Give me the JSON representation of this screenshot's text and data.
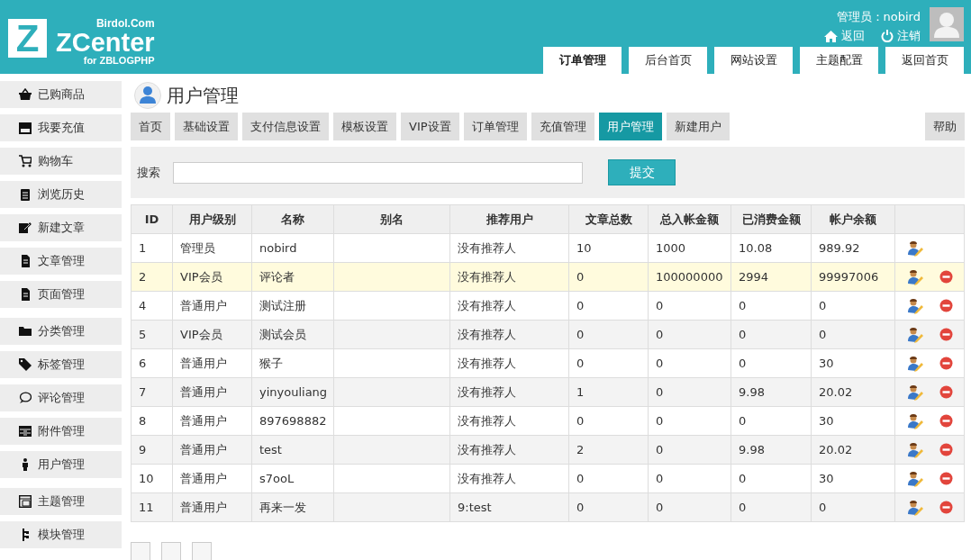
{
  "logo": {
    "letter": "Z",
    "site": "Birdol.Com",
    "name": "ZCenter",
    "sub": "for ZBLOGPHP"
  },
  "user": {
    "label": "管理员：nobird",
    "back": "返回",
    "logout": "注销"
  },
  "top_tabs": [
    {
      "label": "订单管理",
      "selected": true
    },
    {
      "label": "后台首页",
      "selected": false
    },
    {
      "label": "网站设置",
      "selected": false
    },
    {
      "label": "主题配置",
      "selected": false
    },
    {
      "label": "返回首页",
      "selected": false
    }
  ],
  "sidebar": {
    "groups": [
      [
        {
          "label": "已购商品",
          "kind": "basket"
        },
        {
          "label": "我要充值",
          "kind": "store"
        },
        {
          "label": "购物车",
          "kind": "cart"
        },
        {
          "label": "浏览历史",
          "kind": "clipboard"
        },
        {
          "label": "新建文章",
          "kind": "edit"
        },
        {
          "label": "文章管理",
          "kind": "docs"
        },
        {
          "label": "页面管理",
          "kind": "docs"
        }
      ],
      [
        {
          "label": "分类管理",
          "kind": "folder"
        },
        {
          "label": "标签管理",
          "kind": "tag"
        },
        {
          "label": "评论管理",
          "kind": "comment"
        },
        {
          "label": "附件管理",
          "kind": "drawer"
        },
        {
          "label": "用户管理",
          "kind": "person"
        }
      ],
      [
        {
          "label": "主题管理",
          "kind": "layout"
        },
        {
          "label": "模块管理",
          "kind": "tree"
        }
      ]
    ]
  },
  "page_title": "用户管理",
  "tabs": [
    {
      "label": "首页",
      "selected": false
    },
    {
      "label": "基础设置",
      "selected": false
    },
    {
      "label": "支付信息设置",
      "selected": false
    },
    {
      "label": "模板设置",
      "selected": false
    },
    {
      "label": "VIP设置",
      "selected": false
    },
    {
      "label": "订单管理",
      "selected": false
    },
    {
      "label": "充值管理",
      "selected": false
    },
    {
      "label": "用户管理",
      "selected": true
    },
    {
      "label": "新建用户",
      "selected": false
    }
  ],
  "help": "帮助",
  "search": {
    "label": "搜索",
    "submit": "提交"
  },
  "table": {
    "columns": [
      "ID",
      "用户级别",
      "名称",
      "别名",
      "推荐用户",
      "文章总数",
      "总入帐金额",
      "已消费金额",
      "帐户余额"
    ],
    "rows": [
      {
        "cells": [
          "1",
          "管理员",
          "nobird",
          "",
          "没有推荐人",
          "10",
          "1000",
          "10.08",
          "989.92"
        ],
        "highlighted": false,
        "deletable": false
      },
      {
        "cells": [
          "2",
          "VIP会员",
          "评论者",
          "",
          "没有推荐人",
          "0",
          "100000000",
          "2994",
          "99997006"
        ],
        "highlighted": true,
        "deletable": true
      },
      {
        "cells": [
          "4",
          "普通用户",
          "测试注册",
          "",
          "没有推荐人",
          "0",
          "0",
          "0",
          "0"
        ],
        "highlighted": false,
        "deletable": true
      },
      {
        "cells": [
          "5",
          "VIP会员",
          "测试会员",
          "",
          "没有推荐人",
          "0",
          "0",
          "0",
          "0"
        ],
        "highlighted": false,
        "deletable": true
      },
      {
        "cells": [
          "6",
          "普通用户",
          "猴子",
          "",
          "没有推荐人",
          "0",
          "0",
          "0",
          "30"
        ],
        "highlighted": false,
        "deletable": true
      },
      {
        "cells": [
          "7",
          "普通用户",
          "yinyouliang",
          "",
          "没有推荐人",
          "1",
          "0",
          "9.98",
          "20.02"
        ],
        "highlighted": false,
        "deletable": true
      },
      {
        "cells": [
          "8",
          "普通用户",
          "897698882",
          "",
          "没有推荐人",
          "0",
          "0",
          "0",
          "30"
        ],
        "highlighted": false,
        "deletable": true
      },
      {
        "cells": [
          "9",
          "普通用户",
          "test",
          "",
          "没有推荐人",
          "2",
          "0",
          "9.98",
          "20.02"
        ],
        "highlighted": false,
        "deletable": true
      },
      {
        "cells": [
          "10",
          "普通用户",
          "s7ooL",
          "",
          "没有推荐人",
          "0",
          "0",
          "0",
          "30"
        ],
        "highlighted": false,
        "deletable": true
      },
      {
        "cells": [
          "11",
          "普通用户",
          "再来一发",
          "",
          "9:test",
          "0",
          "0",
          "0",
          "0"
        ],
        "highlighted": false,
        "deletable": true
      }
    ]
  }
}
